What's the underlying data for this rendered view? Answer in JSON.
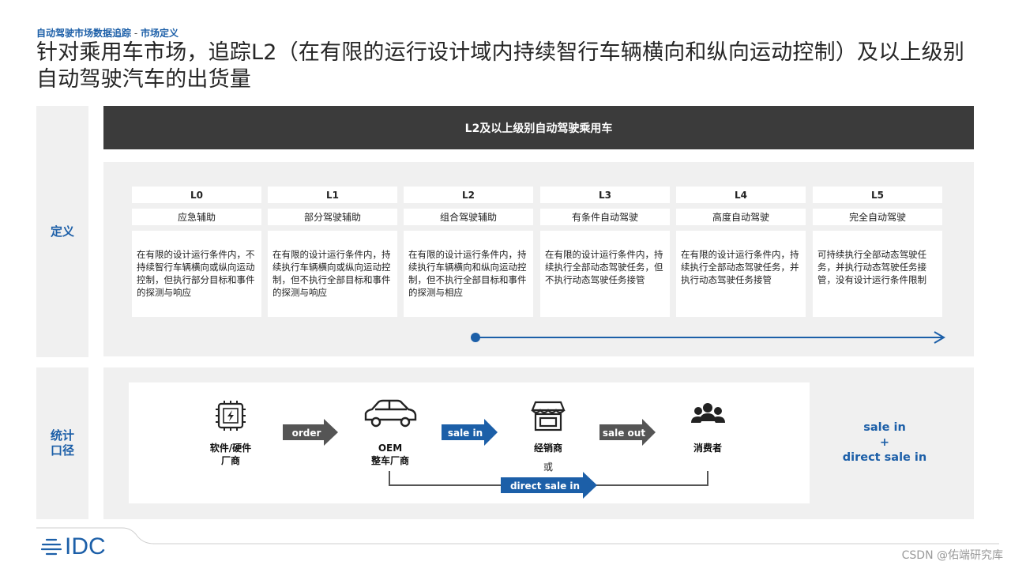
{
  "header": {
    "breadcrumb_main": "自动驾驶市场数据追踪",
    "breadcrumb_sep": " - ",
    "breadcrumb_sub": "市场定义",
    "title": "针对乘用车市场，追踪L2（在有限的运行设计域内持续智行车辆横向和纵向运动控制）及以上级别自动驾驶汽车的出货量"
  },
  "side_labels": {
    "definition": "定义",
    "statistics": "统计口径"
  },
  "banner": "L2及以上级别自动驾驶乘用车",
  "levels": [
    {
      "code": "L0",
      "name": "应急辅助",
      "desc": "在有限的设计运行条件内，不持续智行车辆横向或纵向运动控制，但执行部分目标和事件的探测与响应"
    },
    {
      "code": "L1",
      "name": "部分驾驶辅助",
      "desc": "在有限的设计运行条件内，持续执行车辆横向或纵向运动控制，但不执行全部目标和事件的探测与响应"
    },
    {
      "code": "L2",
      "name": "组合驾驶辅助",
      "desc": "在有限的设计运行条件内，持续执行车辆横向和纵向运动控制，但不执行全部目标和事件的探测与相应"
    },
    {
      "code": "L3",
      "name": "有条件自动驾驶",
      "desc": "在有限的设计运行条件内，持续执行全部动态驾驶任务，但不执行动态驾驶任务接管"
    },
    {
      "code": "L4",
      "name": "高度自动驾驶",
      "desc": "在有限的设计运行条件内，持续执行全部动态驾驶任务，并执行动态驾驶任务接管"
    },
    {
      "code": "L5",
      "name": "完全自动驾驶",
      "desc": "可持续执行全部动态驾驶任务，并执行动态驾驶任务接管，没有设计运行条件限制"
    }
  ],
  "flow": {
    "supplier": "软件/硬件厂商",
    "supplier_l1": "软件/硬件",
    "supplier_l2": "厂商",
    "oem_l1": "OEM",
    "oem_l2": "整车厂商",
    "dealer": "经销商",
    "or": "或",
    "consumer": "消费者",
    "arrow_order": "order",
    "arrow_sale_in": "sale in",
    "arrow_sale_out": "sale out",
    "arrow_direct": "direct sale in",
    "icons": [
      "chip-icon",
      "car-icon",
      "store-icon",
      "people-icon"
    ]
  },
  "summary": {
    "line1": "sale in",
    "line2": "+",
    "line3": "direct sale in"
  },
  "colors": {
    "brand_blue": "#1c5fa8",
    "dark_grey": "#3b3b3b",
    "arrow_grey": "#555555",
    "panel_grey": "#f0f0f0"
  },
  "footer": {
    "logo": "IDC",
    "watermark": "CSDN @佑端研究库"
  }
}
